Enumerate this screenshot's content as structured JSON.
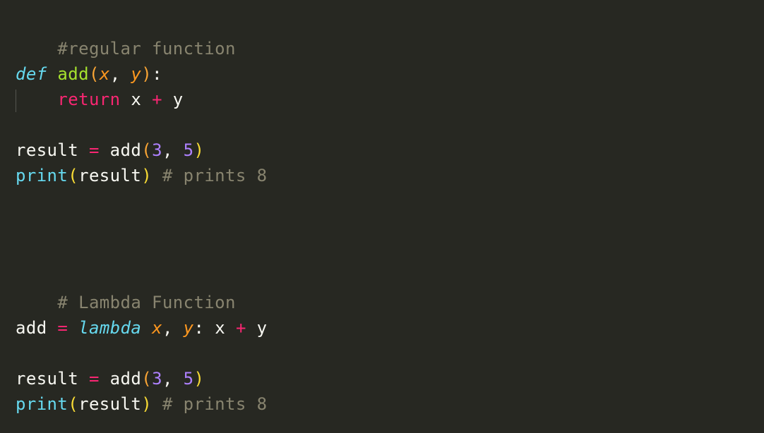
{
  "editor": {
    "theme_colors": {
      "background": "#272822",
      "comment": "#88846f",
      "keyword": "#f92672",
      "storage": "#66d9ef",
      "function_name": "#a6e22e",
      "parameter": "#fd971f",
      "number": "#ae81ff",
      "text": "#f8f8f2",
      "bracket": "#f9dc35"
    },
    "line1": {
      "comment": "#regular function"
    },
    "line3": {
      "def": "def",
      "name": "add",
      "open": "(",
      "p1": "x",
      "comma": ", ",
      "p2": "y",
      "close": ")",
      "colon": ":"
    },
    "line4": {
      "indent": "    ",
      "ret": "return",
      "expr_a": " x ",
      "op": "+",
      "expr_b": " y"
    },
    "line6": {
      "var": "result",
      "sp1": " ",
      "eq": "=",
      "call": " add",
      "open": "(",
      "n1": "3",
      "comma": ", ",
      "n2": "5",
      "close": ")"
    },
    "line7": {
      "fn": "print",
      "open": "(",
      "arg": "result",
      "close": ")",
      "comment": " # prints 8"
    },
    "line12": {
      "comment": "# Lambda Function"
    },
    "line14": {
      "var": "add",
      "sp1": " ",
      "eq": "=",
      "sp2": " ",
      "lambda": "lambda",
      "sp3": " ",
      "p1": "x",
      "comma": ", ",
      "p2": "y",
      "colon": ":",
      "expr_a": " x ",
      "op": "+",
      "expr_b": " y"
    },
    "line16": {
      "var": "result",
      "sp1": " ",
      "eq": "=",
      "call": " add",
      "open": "(",
      "n1": "3",
      "comma": ", ",
      "n2": "5",
      "close": ")"
    },
    "line17": {
      "fn": "print",
      "open": "(",
      "arg": "result",
      "close": ")",
      "comment": " # prints 8"
    }
  }
}
